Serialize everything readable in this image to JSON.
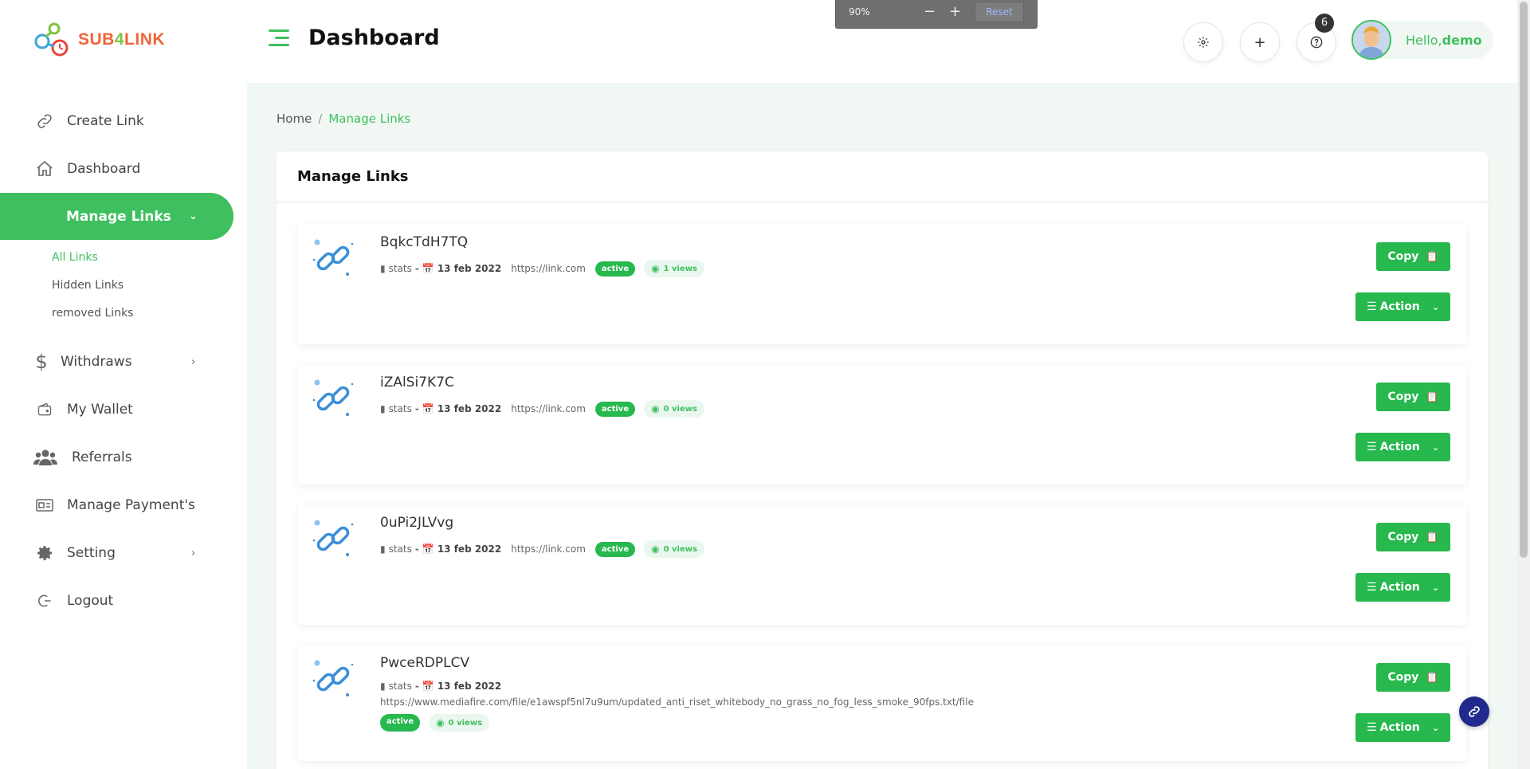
{
  "brand": {
    "logo_text_a": "SUB",
    "logo_text_b": "4",
    "logo_text_c": "LINK"
  },
  "header": {
    "title": "Dashboard",
    "zoom": {
      "value": "90%",
      "minus": "−",
      "plus": "+",
      "reset": "Reset"
    },
    "notification_count": "6",
    "greeting": "Hello,",
    "username": "demo"
  },
  "sidebar": {
    "items": [
      {
        "label": "Create Link",
        "icon": "link-icon"
      },
      {
        "label": "Dashboard",
        "icon": "home-icon"
      },
      {
        "label": "Manage Links",
        "icon": "chevron-down-icon"
      },
      {
        "label": "Withdraws",
        "icon": "dollar-icon"
      },
      {
        "label": "My Wallet",
        "icon": "wallet-icon"
      },
      {
        "label": "Referrals",
        "icon": "users-icon"
      },
      {
        "label": "Manage Payment's",
        "icon": "payment-card-icon"
      },
      {
        "label": "Setting",
        "icon": "gear-icon"
      },
      {
        "label": "Logout",
        "icon": "logout-icon"
      }
    ],
    "sub_items": [
      "All Links",
      "Hidden Links",
      "removed Links"
    ]
  },
  "breadcrumb": {
    "home": "Home",
    "separator": "/",
    "current": "Manage Links"
  },
  "card": {
    "title": "Manage Links"
  },
  "links": [
    {
      "name": "BqkcTdH7TQ",
      "stats": "stats",
      "dash": "-",
      "date": "13 feb 2022",
      "url": "https://link.com",
      "status": "active",
      "views": "1 views"
    },
    {
      "name": "iZAlSi7K7C",
      "stats": "stats",
      "dash": "-",
      "date": "13 feb 2022",
      "url": "https://link.com",
      "status": "active",
      "views": "0 views"
    },
    {
      "name": "0uPi2JLVvg",
      "stats": "stats",
      "dash": "-",
      "date": "13 feb 2022",
      "url": "https://link.com",
      "status": "active",
      "views": "0 views"
    },
    {
      "name": "PwceRDPLCV",
      "stats": "stats",
      "dash": "-",
      "date": "13 feb 2022",
      "url": "https://www.mediafire.com/file/e1awspf5nl7u9um/updated_anti_riset_whitebody_no_grass_no_fog_less_smoke_90fps.txt/file",
      "status": "active",
      "views": "0 views"
    }
  ],
  "buttons": {
    "copy": "Copy",
    "action": "Action"
  },
  "colors": {
    "accent": "#3fbf5f",
    "button": "#27b84e",
    "content_bg": "#f1f8f3",
    "fab": "#1f2a8c"
  }
}
